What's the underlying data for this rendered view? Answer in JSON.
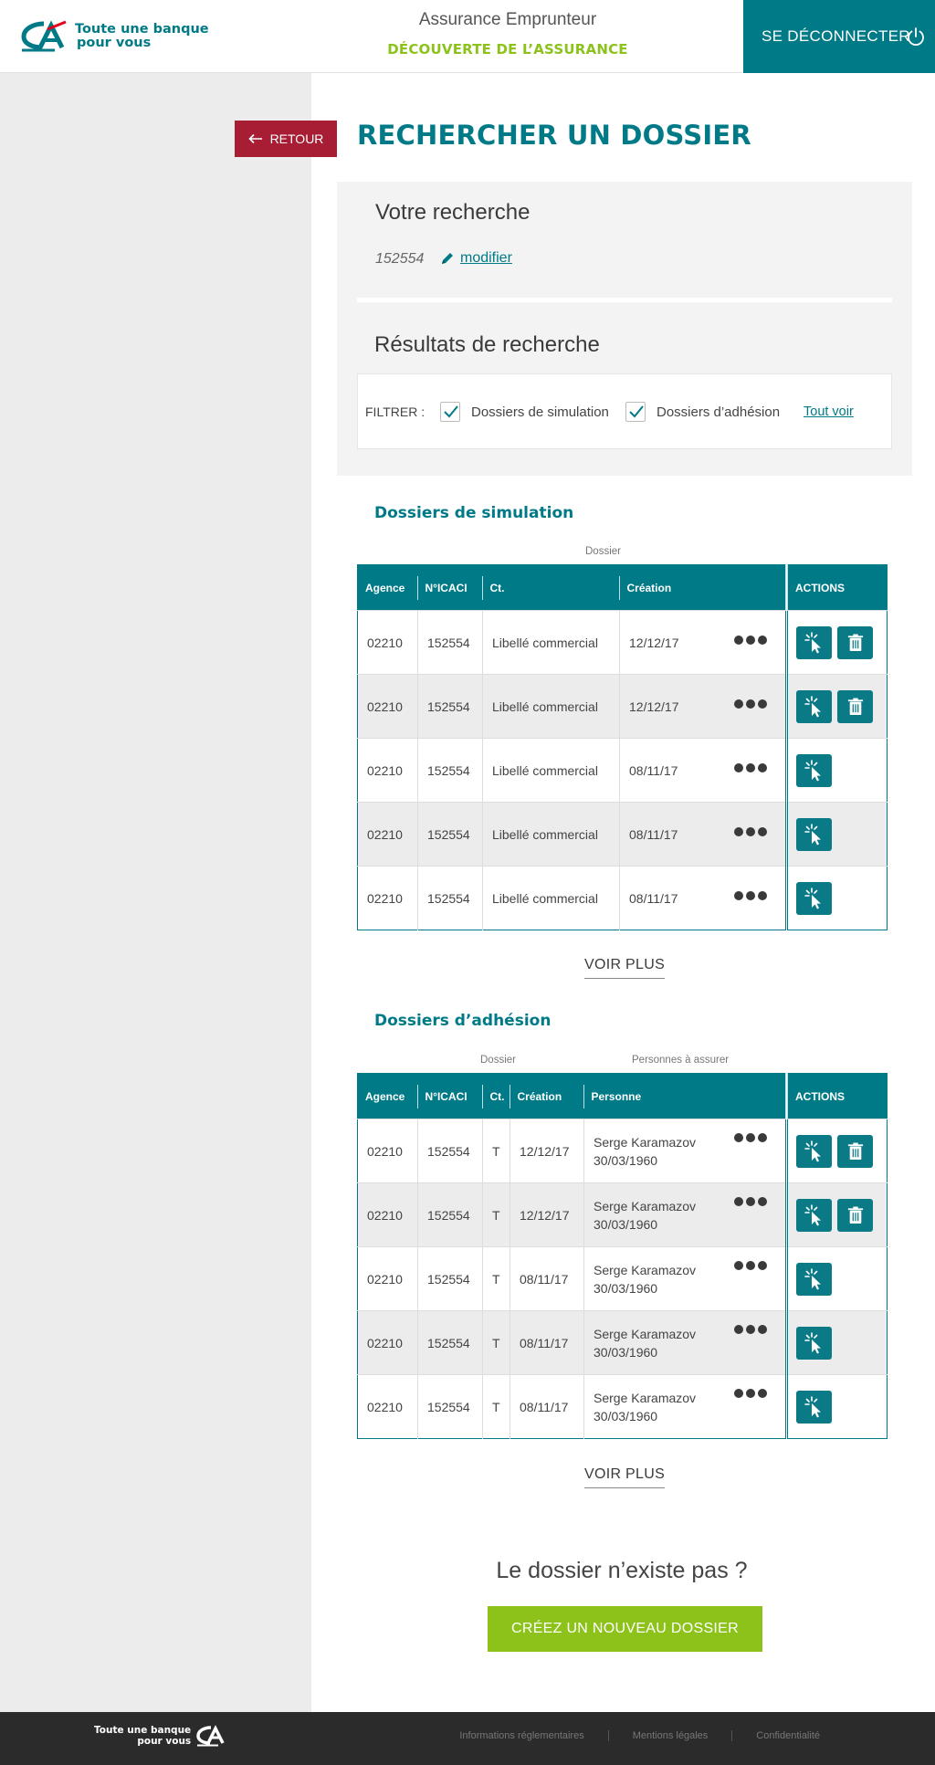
{
  "header": {
    "brand_line1": "Toute une banque",
    "brand_line2": "pour vous",
    "title": "Assurance Emprunteur",
    "subtitle": "DÉCOUVERTE DE L’ASSURANCE",
    "logout_label": "SE DÉCONNECTER"
  },
  "page": {
    "back_label": "RETOUR",
    "title": "RECHERCHER UN DOSSIER"
  },
  "search": {
    "heading": "Votre recherche",
    "value": "152554",
    "edit_label": "modifier",
    "results_heading": "Résultats de recherche",
    "filter_label": "FILTRER :",
    "filters": [
      {
        "label": "Dossiers de simulation",
        "checked": true
      },
      {
        "label": "Dossiers d’adhésion",
        "checked": true
      }
    ],
    "see_all_label": "Tout voir"
  },
  "simulation": {
    "title": "Dossiers de simulation",
    "group_label": "Dossier",
    "columns": [
      "Agence",
      "N°ICACI",
      "Ct.",
      "Création",
      "ACTIONS"
    ],
    "rows": [
      {
        "agence": "02210",
        "icaci": "152554",
        "ct": "Libellé commercial",
        "creation": "12/12/17",
        "delete": true
      },
      {
        "agence": "02210",
        "icaci": "152554",
        "ct": "Libellé commercial",
        "creation": "12/12/17",
        "delete": true
      },
      {
        "agence": "02210",
        "icaci": "152554",
        "ct": "Libellé commercial",
        "creation": "08/11/17",
        "delete": false
      },
      {
        "agence": "02210",
        "icaci": "152554",
        "ct": "Libellé commercial",
        "creation": "08/11/17",
        "delete": false
      },
      {
        "agence": "02210",
        "icaci": "152554",
        "ct": "Libellé commercial",
        "creation": "08/11/17",
        "delete": false
      }
    ],
    "more_label": "VOIR PLUS"
  },
  "adhesion": {
    "title": "Dossiers d’adhésion",
    "group_label_1": "Dossier",
    "group_label_2": "Personnes à assurer",
    "columns": [
      "Agence",
      "N°ICACI",
      "Ct.",
      "Création",
      "Personne",
      "ACTIONS"
    ],
    "rows": [
      {
        "agence": "02210",
        "icaci": "152554",
        "ct": "T",
        "creation": "12/12/17",
        "name": "Serge Karamazov",
        "birth": "30/03/1960",
        "delete": true
      },
      {
        "agence": "02210",
        "icaci": "152554",
        "ct": "T",
        "creation": "12/12/17",
        "name": "Serge Karamazov",
        "birth": "30/03/1960",
        "delete": true
      },
      {
        "agence": "02210",
        "icaci": "152554",
        "ct": "T",
        "creation": "08/11/17",
        "name": "Serge Karamazov",
        "birth": "30/03/1960",
        "delete": false
      },
      {
        "agence": "02210",
        "icaci": "152554",
        "ct": "T",
        "creation": "08/11/17",
        "name": "Serge Karamazov",
        "birth": "30/03/1960",
        "delete": false
      },
      {
        "agence": "02210",
        "icaci": "152554",
        "ct": "T",
        "creation": "08/11/17",
        "name": "Serge Karamazov",
        "birth": "30/03/1960",
        "delete": false
      }
    ],
    "more_label": "VOIR PLUS"
  },
  "notfound": {
    "question": "Le dossier n’existe pas ?",
    "create_label": "CRÉEZ UN NOUVEAU DOSSIER"
  },
  "footer": {
    "brand_line1": "Toute une banque",
    "brand_line2": "pour vous",
    "links": [
      "Informations réglementaires",
      "Mentions légales",
      "Confidentialité"
    ]
  },
  "colors": {
    "primary": "#007a87",
    "accent_green": "#8cc21a",
    "back_red": "#a71d34"
  }
}
